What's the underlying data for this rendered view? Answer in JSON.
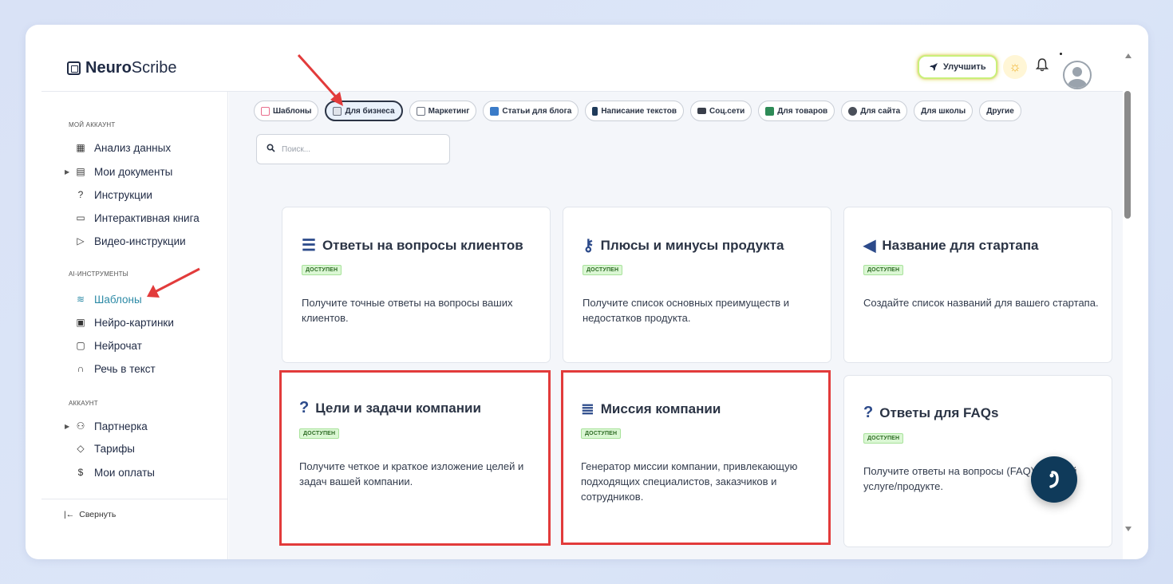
{
  "app": {
    "logo_bold": "Neuro",
    "logo_light": "Scribe",
    "upgrade_label": "Улучшить"
  },
  "sidebar": {
    "sections": [
      {
        "title": "МОЙ АККАУНТ"
      },
      {
        "title": "AI-ИНСТРУМЕНТЫ"
      },
      {
        "title": "АККАУНТ"
      }
    ],
    "items": [
      {
        "label": "Анализ данных",
        "icon": "grid-icon"
      },
      {
        "label": "Мои документы",
        "icon": "document-icon"
      },
      {
        "label": "Инструкции",
        "icon": "help-icon"
      },
      {
        "label": "Интерактивная книга",
        "icon": "book-icon"
      },
      {
        "label": "Видео-инструкции",
        "icon": "video-icon"
      },
      {
        "label": "Шаблоны",
        "icon": "layers-icon"
      },
      {
        "label": "Нейро-картинки",
        "icon": "image-icon"
      },
      {
        "label": "Нейрочат",
        "icon": "chat-icon"
      },
      {
        "label": "Речь в текст",
        "icon": "headphones-icon"
      },
      {
        "label": "Партнерка",
        "icon": "users-icon"
      },
      {
        "label": "Тарифы",
        "icon": "tag-icon"
      },
      {
        "label": "Мои оплаты",
        "icon": "dollar-icon"
      }
    ],
    "collapse_label": "Свернуть"
  },
  "chips": [
    {
      "label": "Шаблоны",
      "color": "#e96d8c"
    },
    {
      "label": "Для бизнеса",
      "color": "#8c8f94"
    },
    {
      "label": "Маркетинг",
      "color": "#6b7280"
    },
    {
      "label": "Статьи для блога",
      "color": "#3a7bc8"
    },
    {
      "label": "Написание текстов",
      "color": "#1f3b5a"
    },
    {
      "label": "Соц.сети",
      "color": "#3a3f4a"
    },
    {
      "label": "Для товаров",
      "color": "#2e8b57"
    },
    {
      "label": "Для сайта",
      "color": "#4a4f59"
    },
    {
      "label": "Для школы",
      "color": ""
    },
    {
      "label": "Другие",
      "color": ""
    }
  ],
  "search": {
    "placeholder": "Поиск..."
  },
  "badge_label": "ДОСТУПЕН",
  "cards": [
    {
      "title": "Ответы на вопросы клиентов",
      "icon": "list-icon",
      "desc": "Получите точные ответы на вопросы ваших клиентов."
    },
    {
      "title": "Плюсы и минусы продукта",
      "icon": "key-icon",
      "desc": "Получите список основных преимуществ и недостатков продукта."
    },
    {
      "title": "Название для стартапа",
      "icon": "megaphone-icon",
      "desc": "Создайте список названий для вашего стартапа."
    },
    {
      "title": "Цели и задачи компании",
      "icon": "question-icon",
      "desc": "Получите четкое и краткое изложение целей и задач вашей компании."
    },
    {
      "title": "Миссия компании",
      "icon": "lines-icon",
      "desc": "Генератор миссии компании, привлекающую подходящих специалистов, заказчиков и сотрудников."
    },
    {
      "title": "Ответы для FAQs",
      "icon": "question-icon",
      "desc": "Получите ответы на вопросы (FAQ) о вашей услуге/продукте."
    }
  ],
  "colors": {
    "accent": "#2c8aa6",
    "highlight": "#e23b3b",
    "badge_bg": "#dbf7d4",
    "fab": "#0f3a5a"
  }
}
